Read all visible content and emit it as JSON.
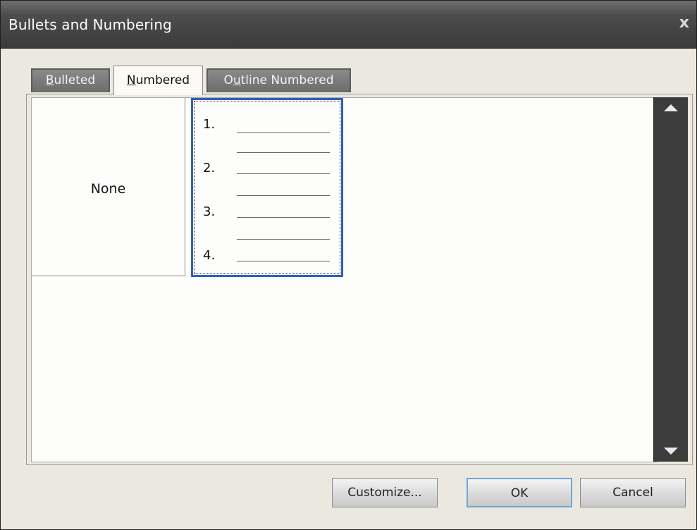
{
  "window": {
    "title": "Bullets and Numbering",
    "close_glyph": "x"
  },
  "tabs": [
    {
      "label": "Bulleted",
      "mnemonic": "B",
      "rest": "ulleted",
      "active": false
    },
    {
      "label": "Numbered",
      "mnemonic": "N",
      "rest": "umbered",
      "active": true
    },
    {
      "label": "Outline Numbered",
      "pre": "O",
      "mnemonic": "u",
      "rest": "tline Numbered",
      "active": false
    }
  ],
  "styles": {
    "none_label": "None",
    "numbered_items": [
      "1.",
      "2.",
      "3.",
      "4."
    ]
  },
  "buttons": {
    "customize": "Customize...",
    "ok": "OK",
    "cancel": "Cancel"
  },
  "colors": {
    "selection_border": "#2f5fc0",
    "title_bar": "#3b3b3b",
    "scrollbar": "#3c3c3c"
  }
}
